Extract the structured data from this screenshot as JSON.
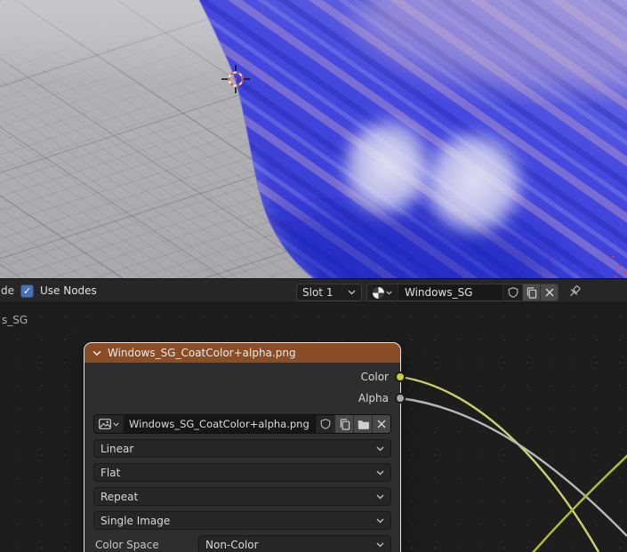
{
  "colors": {
    "accent": "#4772b3",
    "node_header": "#8b4d26",
    "socket-color": "#cdcd34",
    "socket-alpha": "#a8a8a8",
    "link-color": "#cdd06e",
    "link-alpha": "#b9b9b9",
    "link-yellow": "#b5bf2c",
    "object-blue": "#4144dc",
    "cursor-red": "#d84a45"
  },
  "shader_header": {
    "truncated_left": "de",
    "use_nodes_label": "Use Nodes",
    "use_nodes_checked": true,
    "check_glyph": "✓",
    "slot_value": "Slot 1",
    "material_name": "Windows_SG"
  },
  "node_editor": {
    "path_overlay": "s_SG",
    "node": {
      "title": "Windows_SG_CoatColor+alpha.png",
      "outputs": [
        {
          "label": "Color"
        },
        {
          "label": "Alpha"
        }
      ],
      "image_name": "Windows_SG_CoatColor+alpha.png",
      "interpolation": "Linear",
      "projection": "Flat",
      "extension": "Repeat",
      "source": "Single Image",
      "color_space_label": "Color Space",
      "color_space_value": "Non-Color"
    }
  }
}
